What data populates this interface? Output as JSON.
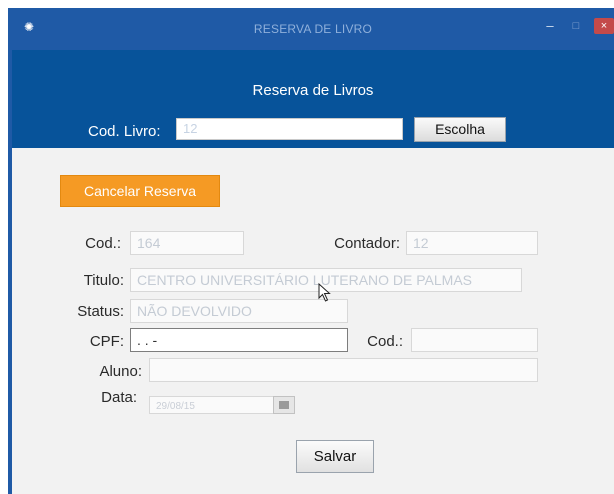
{
  "window": {
    "title": "RESERVA DE LIVRO",
    "icon": "app-icon",
    "controls": {
      "minimize": "–",
      "maximize": "□",
      "close": "×"
    }
  },
  "header": {
    "title": "Reserva de Livros",
    "cod_livro_label": "Cod. Livro:",
    "cod_livro_value": "12",
    "escolha_label": "Escolha"
  },
  "actions": {
    "cancelar_label": "Cancelar Reserva",
    "salvar_label": "Salvar"
  },
  "form": {
    "cod_label": "Cod.:",
    "cod_value": "164",
    "contador_label": "Contador:",
    "contador_value": "12",
    "titulo_label": "Titulo:",
    "titulo_value": "CENTRO UNIVERSITÁRIO LUTERANO DE PALMAS",
    "status_label": "Status:",
    "status_value": "NÃO DEVOLVIDO",
    "cpf_label": "CPF:",
    "cpf_value": "  .   .   -",
    "cod2_label": "Cod.:",
    "cod2_value": "",
    "aluno_label": "Aluno:",
    "aluno_value": "",
    "data_label": "Data:",
    "data_value": "29/08/15"
  },
  "colors": {
    "titlebar": "#1f5aa6",
    "header": "#07539a",
    "accent_orange": "#f59a24"
  }
}
